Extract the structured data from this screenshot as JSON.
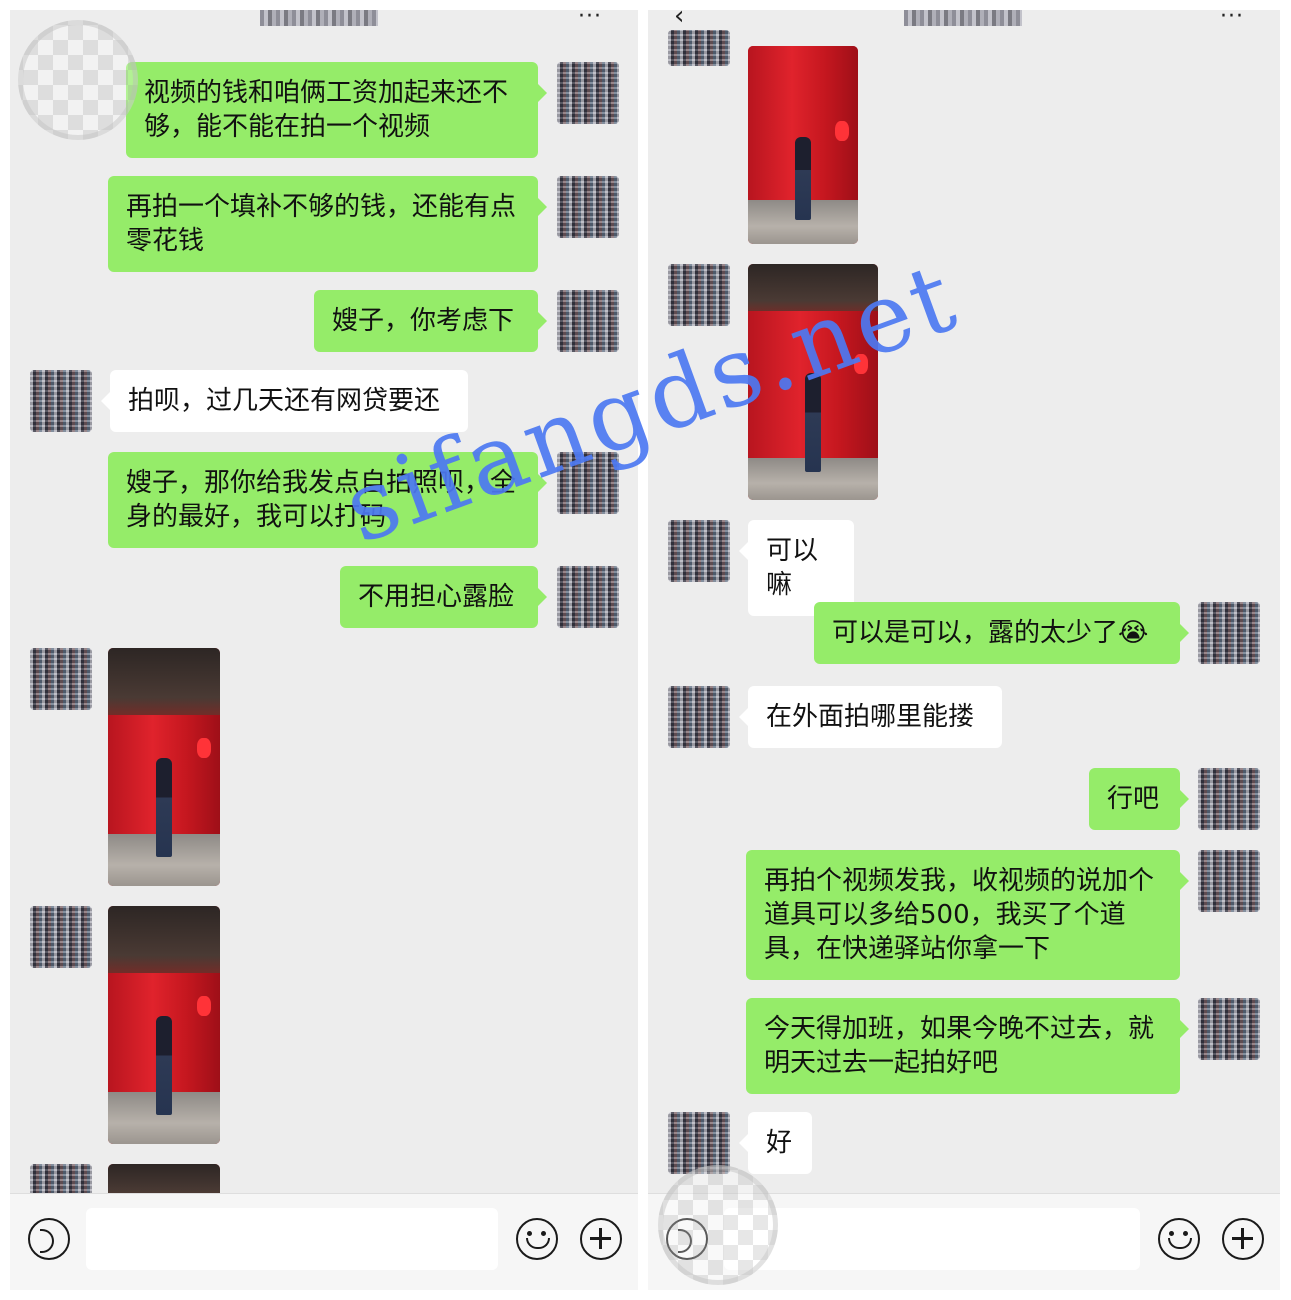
{
  "left_chat": {
    "messages": [
      {
        "text": "视频的钱和咱俩工资加起来还不够，能不能在拍一个视频"
      },
      {
        "text": "再拍一个填补不够的钱，还能有点零花钱"
      },
      {
        "text": "嫂子，你考虑下"
      },
      {
        "text": "拍呗，过几天还有网贷要还"
      },
      {
        "text": "嫂子，那你给我发点自拍照呗，全身的最好，我可以打码"
      },
      {
        "text": "不用担心露脸"
      }
    ]
  },
  "right_chat": {
    "messages": [
      {
        "text": "可以嘛"
      },
      {
        "text": "可以是可以，露的太少了😭"
      },
      {
        "text": "在外面拍哪里能搂"
      },
      {
        "text": "行吧"
      },
      {
        "text": "再拍个视频发我，收视频的说加个道具可以多给500，我买了个道具，在快递驿站你拿一下"
      },
      {
        "text": "今天得加班，如果今晚不过去，就明天过去一起拍好吧"
      },
      {
        "text": "好"
      }
    ]
  },
  "toolbar": {
    "more_label": "···",
    "back_label": "‹"
  },
  "watermark": {
    "text": "sifangds.net"
  },
  "icons": {
    "voice": "voice-icon",
    "emoji": "emoji-icon",
    "plus": "plus-icon",
    "more": "more-icon",
    "back": "back-icon"
  },
  "colors": {
    "sent_bubble": "#95ec69",
    "received_bubble": "#ffffff",
    "chat_background": "#ededed",
    "watermark": "#4d79f2"
  }
}
